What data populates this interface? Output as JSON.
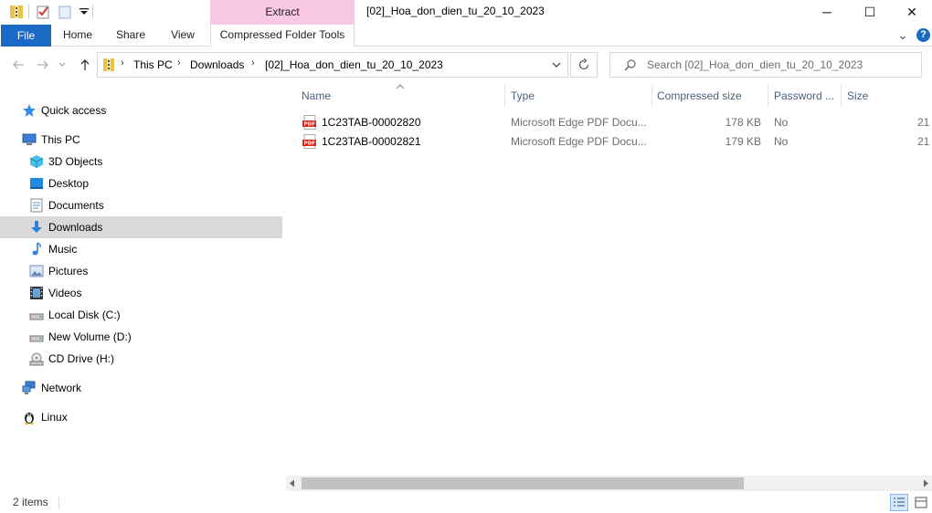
{
  "window": {
    "title": "[02]_Hoa_don_dien_tu_20_10_2023",
    "contextual_group": "Extract",
    "minimize_glyph": "─",
    "maximize_glyph": "☐",
    "close_glyph": "✕"
  },
  "ribbon": {
    "tabs": [
      {
        "label": "File"
      },
      {
        "label": "Home"
      },
      {
        "label": "Share"
      },
      {
        "label": "View"
      },
      {
        "label": "Compressed Folder Tools"
      }
    ],
    "collapse_glyph": "⌄",
    "help_glyph": "?"
  },
  "address": {
    "crumbs": [
      "This PC",
      "Downloads",
      "[02]_Hoa_don_dien_tu_20_10_2023"
    ],
    "search_placeholder": "Search [02]_Hoa_don_dien_tu_20_10_2023"
  },
  "nav": {
    "items": [
      {
        "label": "Quick access",
        "icon": "star-icon"
      },
      {
        "label": "This PC",
        "icon": "computer-icon"
      },
      {
        "label": "3D Objects",
        "icon": "cube-icon"
      },
      {
        "label": "Desktop",
        "icon": "desktop-icon"
      },
      {
        "label": "Documents",
        "icon": "documents-icon"
      },
      {
        "label": "Downloads",
        "icon": "download-arrow-icon",
        "selected": true
      },
      {
        "label": "Music",
        "icon": "music-note-icon"
      },
      {
        "label": "Pictures",
        "icon": "pictures-icon"
      },
      {
        "label": "Videos",
        "icon": "film-icon"
      },
      {
        "label": "Local Disk (C:)",
        "icon": "drive-icon"
      },
      {
        "label": "New Volume (D:)",
        "icon": "drive-icon"
      },
      {
        "label": "CD Drive (H:)",
        "icon": "cd-drive-icon"
      },
      {
        "label": "Network",
        "icon": "network-icon"
      },
      {
        "label": "Linux",
        "icon": "penguin-icon"
      }
    ]
  },
  "columns": {
    "name": "Name",
    "type": "Type",
    "compressed_size": "Compressed size",
    "password": "Password ...",
    "size": "Size"
  },
  "files": [
    {
      "name": "1C23TAB-00002820",
      "type": "Microsoft Edge PDF Docu...",
      "compressed_size": "178 KB",
      "password": "No",
      "size_clip": "21",
      "icon": "pdf-icon"
    },
    {
      "name": "1C23TAB-00002821",
      "type": "Microsoft Edge PDF Docu...",
      "compressed_size": "179 KB",
      "password": "No",
      "size_clip": "21",
      "icon": "pdf-icon"
    }
  ],
  "status": {
    "count": "2 items"
  },
  "colors": {
    "file_tab": "#1a69c4",
    "context_tab": "#f8c8e4",
    "selection": "#d9d9d9",
    "header_text": "#4c607a"
  }
}
